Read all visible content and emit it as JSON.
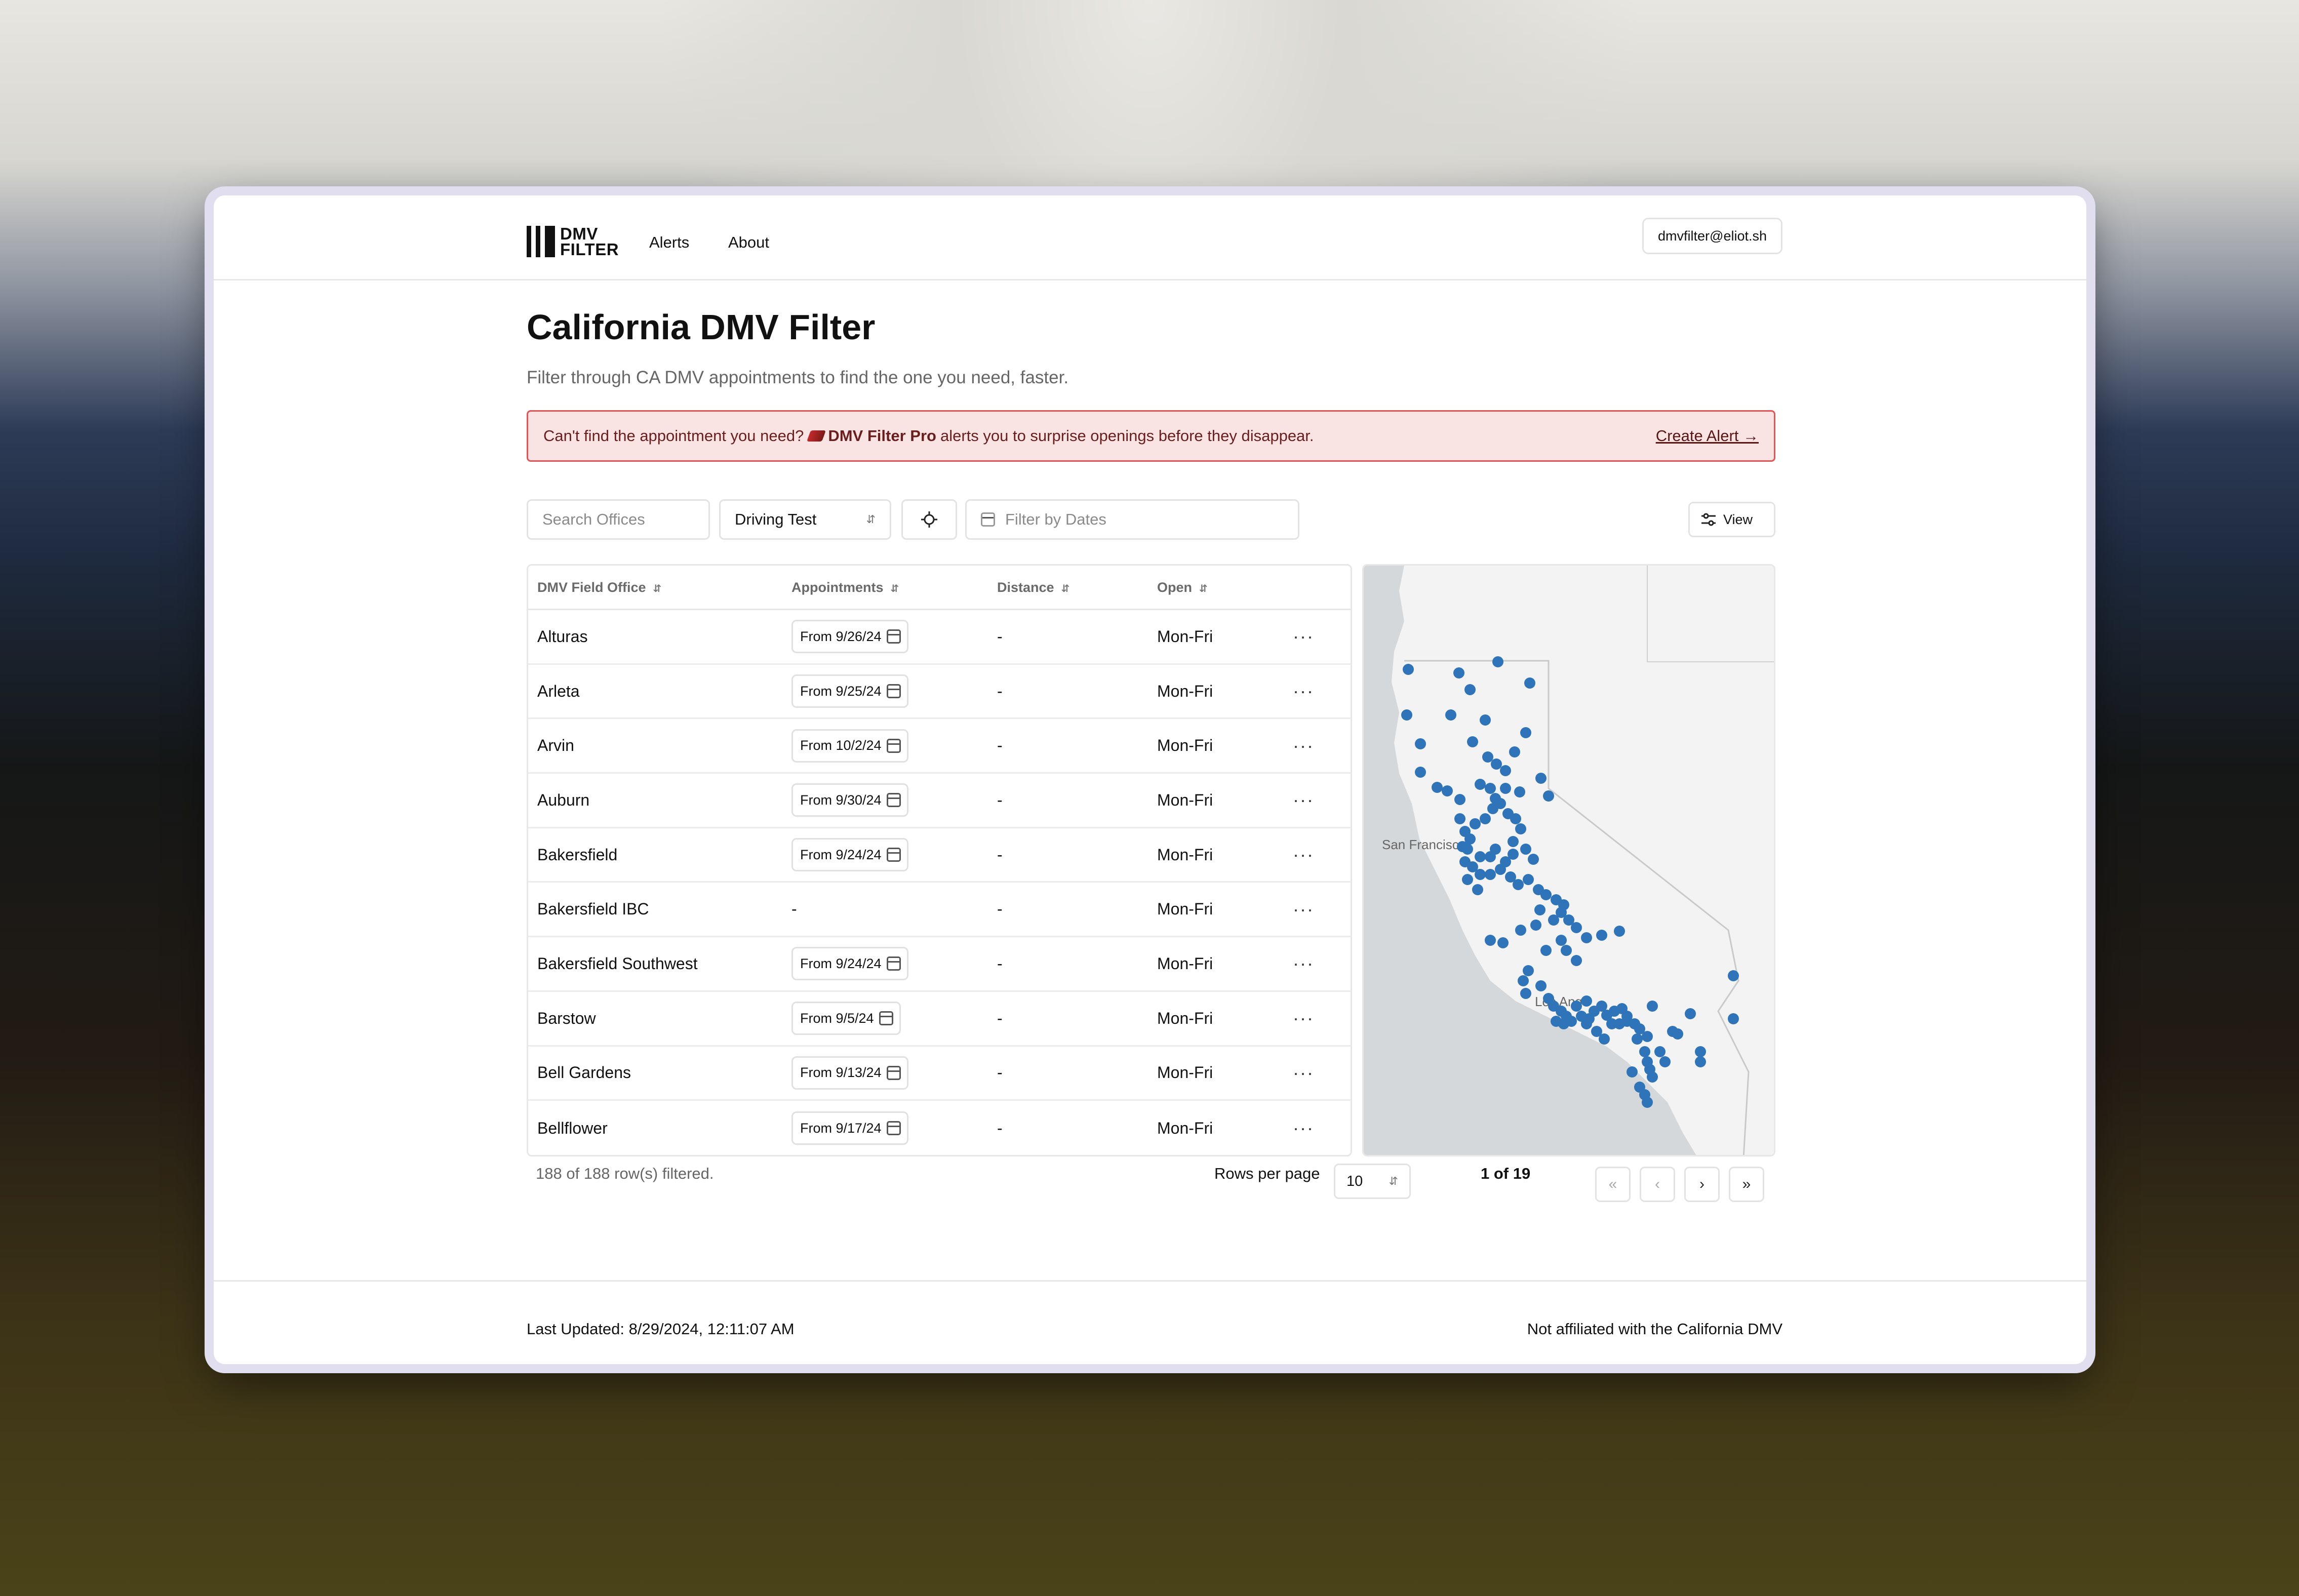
{
  "nav": {
    "logo_line1": "DMV",
    "logo_line2": "FILTER",
    "links": [
      "Alerts",
      "About"
    ],
    "account": "dmvfilter@eliot.sh"
  },
  "header": {
    "title": "California DMV Filter",
    "subtitle": "Filter through CA DMV appointments to find the one you need, faster."
  },
  "banner": {
    "text_before": "Can't find the appointment you need?",
    "pro_name": "DMV Filter Pro",
    "text_after": "alerts you to surprise openings before they disappear.",
    "cta": "Create Alert →"
  },
  "filters": {
    "search_placeholder": "Search Offices",
    "service_value": "Driving Test",
    "dates_placeholder": "Filter by Dates",
    "view_label": "View"
  },
  "table": {
    "columns": [
      "DMV Field Office",
      "Appointments",
      "Distance",
      "Open"
    ],
    "rows": [
      {
        "office": "Alturas",
        "appointment": "From 9/26/24",
        "distance": "-",
        "open": "Mon-Fri"
      },
      {
        "office": "Arleta",
        "appointment": "From 9/25/24",
        "distance": "-",
        "open": "Mon-Fri"
      },
      {
        "office": "Arvin",
        "appointment": "From 10/2/24",
        "distance": "-",
        "open": "Mon-Fri"
      },
      {
        "office": "Auburn",
        "appointment": "From 9/30/24",
        "distance": "-",
        "open": "Mon-Fri"
      },
      {
        "office": "Bakersfield",
        "appointment": "From 9/24/24",
        "distance": "-",
        "open": "Mon-Fri"
      },
      {
        "office": "Bakersfield IBC",
        "appointment": "-",
        "distance": "-",
        "open": "Mon-Fri"
      },
      {
        "office": "Bakersfield Southwest",
        "appointment": "From 9/24/24",
        "distance": "-",
        "open": "Mon-Fri"
      },
      {
        "office": "Barstow",
        "appointment": "From 9/5/24",
        "distance": "-",
        "open": "Mon-Fri"
      },
      {
        "office": "Bell Gardens",
        "appointment": "From 9/13/24",
        "distance": "-",
        "open": "Mon-Fri"
      },
      {
        "office": "Bellflower",
        "appointment": "From 9/17/24",
        "distance": "-",
        "open": "Mon-Fri"
      }
    ]
  },
  "map": {
    "labels": [
      "San Francisco",
      "Los Ange"
    ],
    "marker_color": "#2f73b8"
  },
  "pagination": {
    "rows_filtered": "188 of 188 row(s) filtered.",
    "rows_per_page_label": "Rows per page",
    "rows_per_page_value": "10",
    "page_label": "1 of 19"
  },
  "footer": {
    "last_updated": "Last Updated: 8/29/2024, 12:11:07 AM",
    "disclaimer": "Not affiliated with the California DMV"
  }
}
